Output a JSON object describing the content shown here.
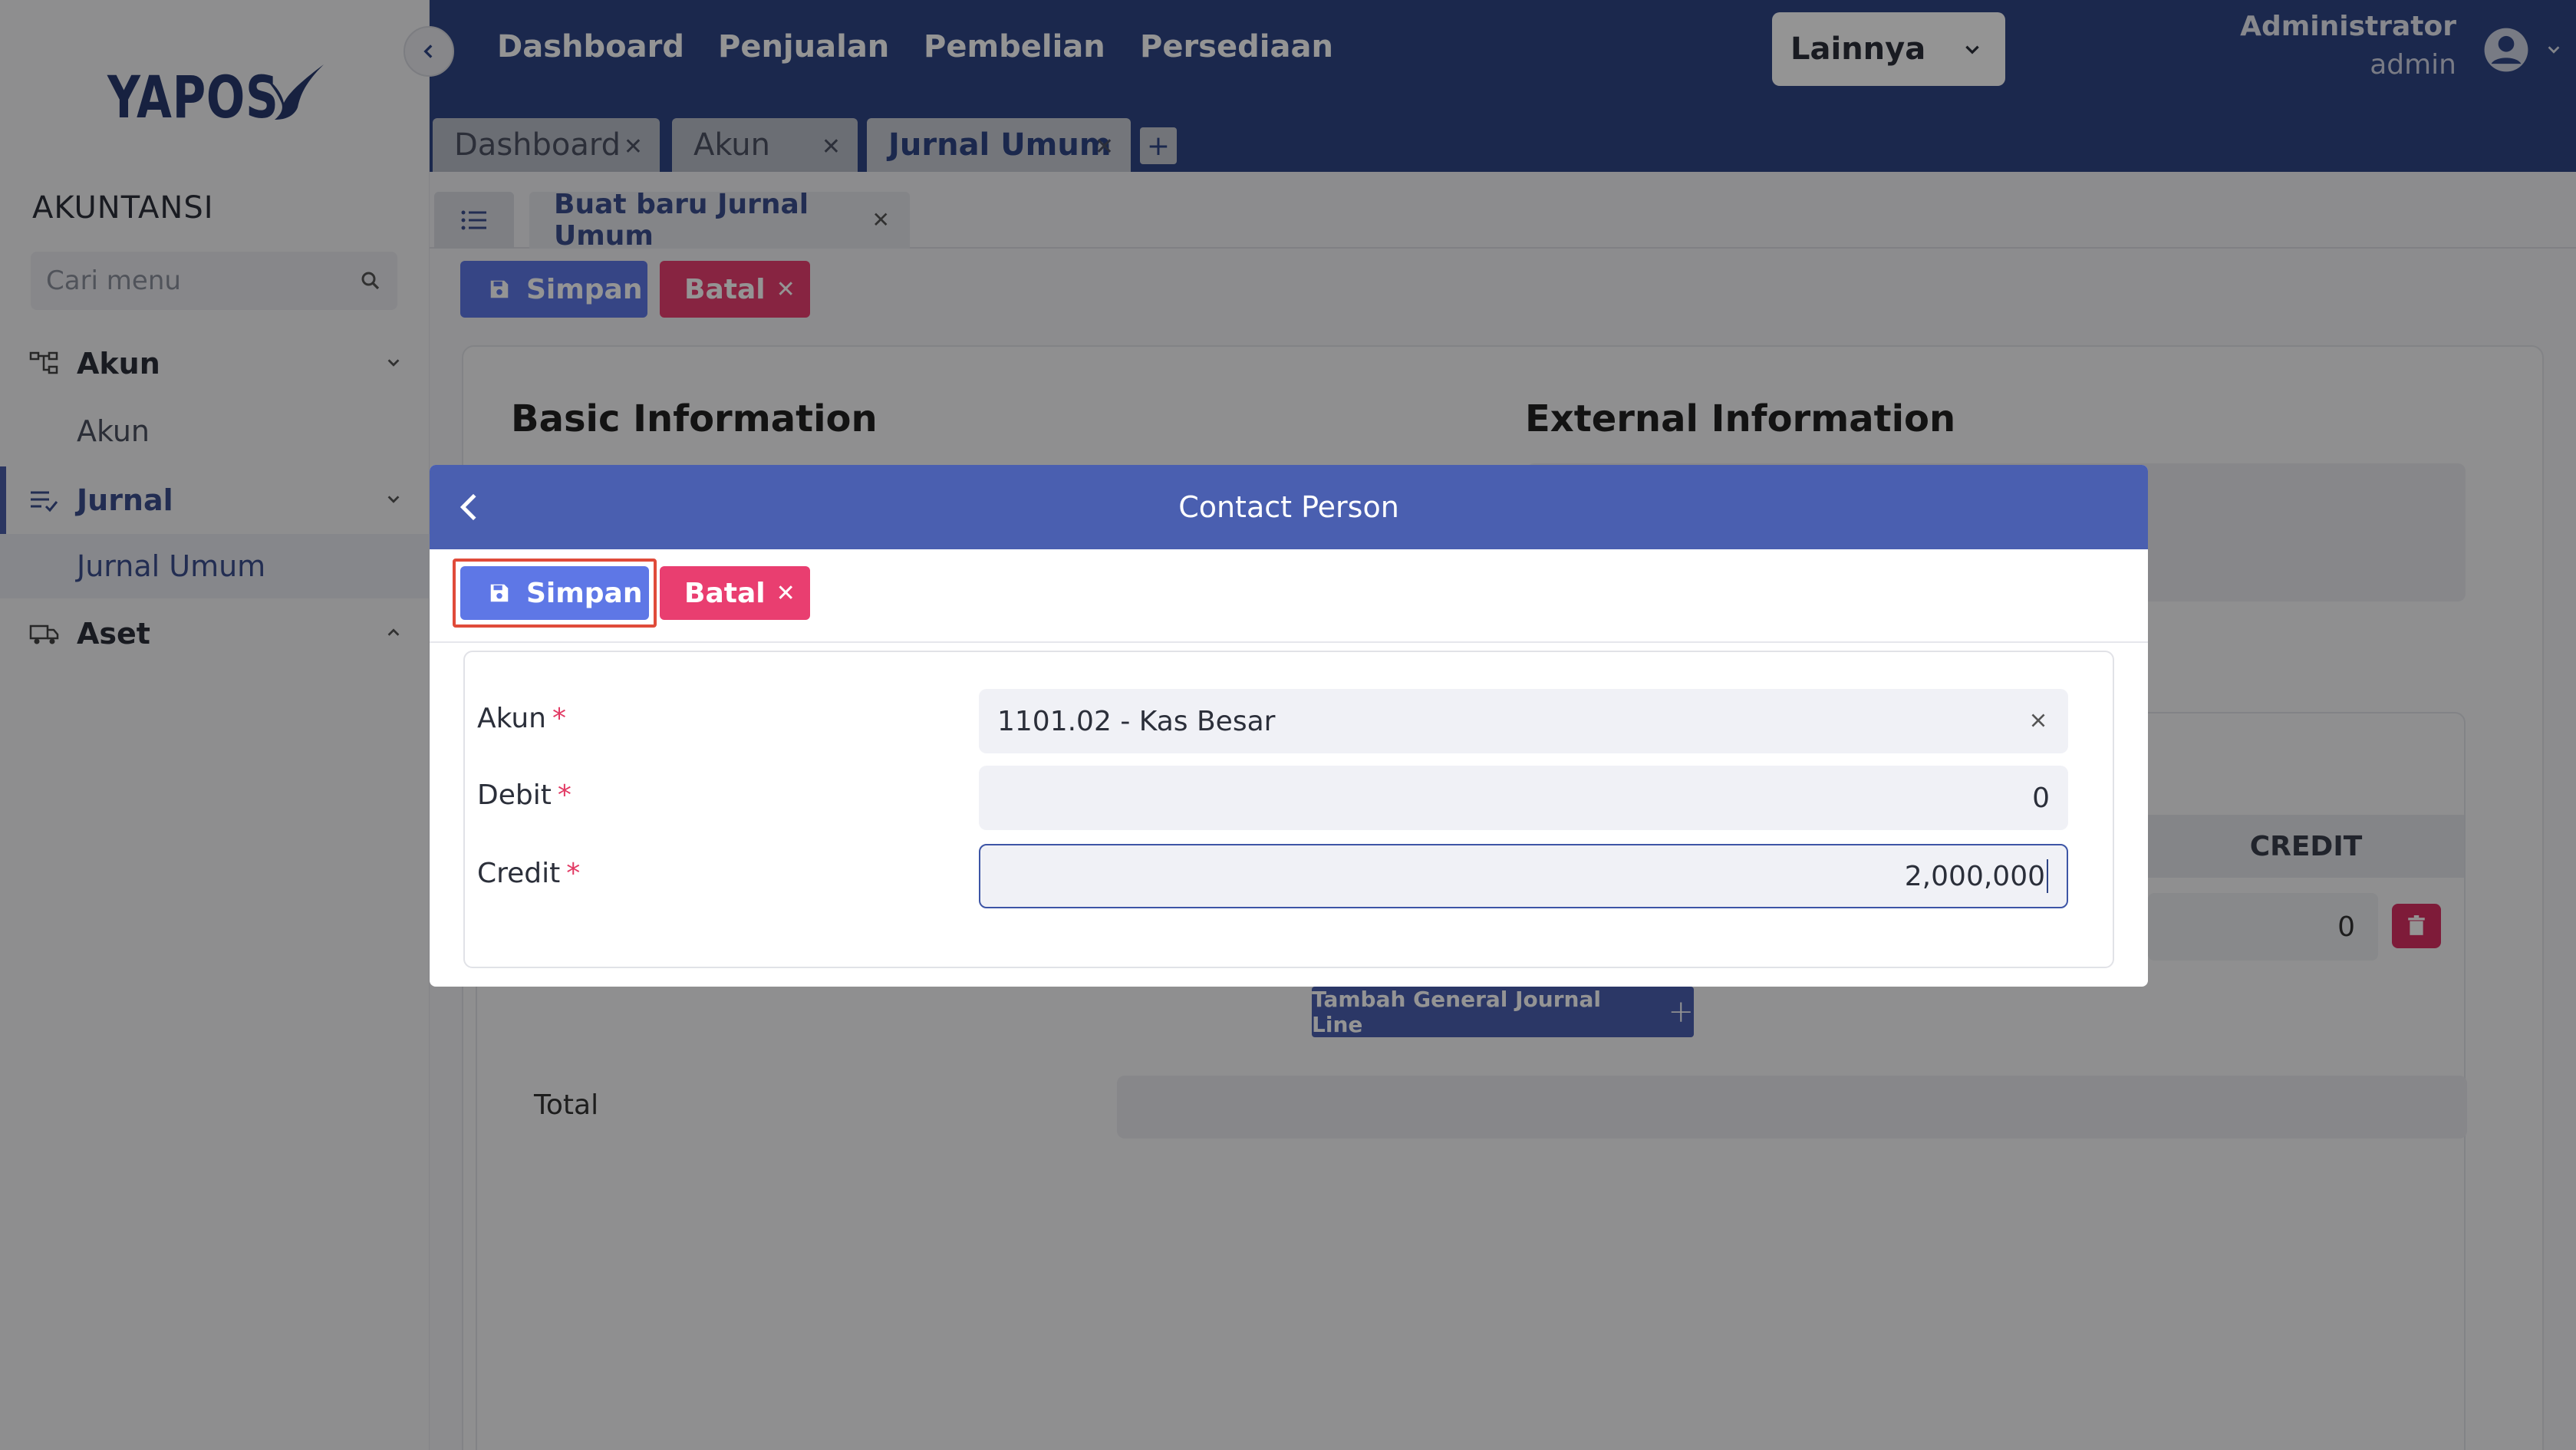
{
  "sidebar": {
    "logo_text": "YAPOS",
    "section_title": "AKUNTANSI",
    "search_placeholder": "Cari menu",
    "groups": [
      {
        "label": "Akun",
        "sub": "Akun"
      },
      {
        "label": "Jurnal",
        "sub": "Jurnal Umum"
      },
      {
        "label": "Aset"
      }
    ]
  },
  "topnav": {
    "items": [
      "Dashboard",
      "Penjualan",
      "Pembelian",
      "Persediaan"
    ],
    "dropdown": "Lainnya",
    "user_name": "Administrator",
    "user_role": "admin"
  },
  "tabs": [
    {
      "label": "Dashboard"
    },
    {
      "label": "Akun"
    },
    {
      "label": "Jurnal Umum"
    }
  ],
  "subtab": {
    "label": "Buat baru Jurnal Umum"
  },
  "page": {
    "save_label": "Simpan",
    "cancel_label": "Batal",
    "basic_info": "Basic Information",
    "external_info": "External Information",
    "credit_header": "CREDIT",
    "credit_value": "0",
    "add_line_label": "Tambah General Journal Line",
    "total_label": "Total"
  },
  "modal": {
    "title": "Contact Person",
    "save_label": "Simpan",
    "cancel_label": "Batal",
    "fields": {
      "akun": {
        "label": "Akun",
        "value": "1101.02 - Kas Besar"
      },
      "debit": {
        "label": "Debit",
        "value": "0"
      },
      "credit": {
        "label": "Credit",
        "value": "2,000,000"
      }
    },
    "required_mark": "*"
  },
  "colors": {
    "primary": "#2f4585",
    "accent": "#5e77e6",
    "danger": "#e93e70",
    "focus_highlight": "#e04b3a"
  }
}
